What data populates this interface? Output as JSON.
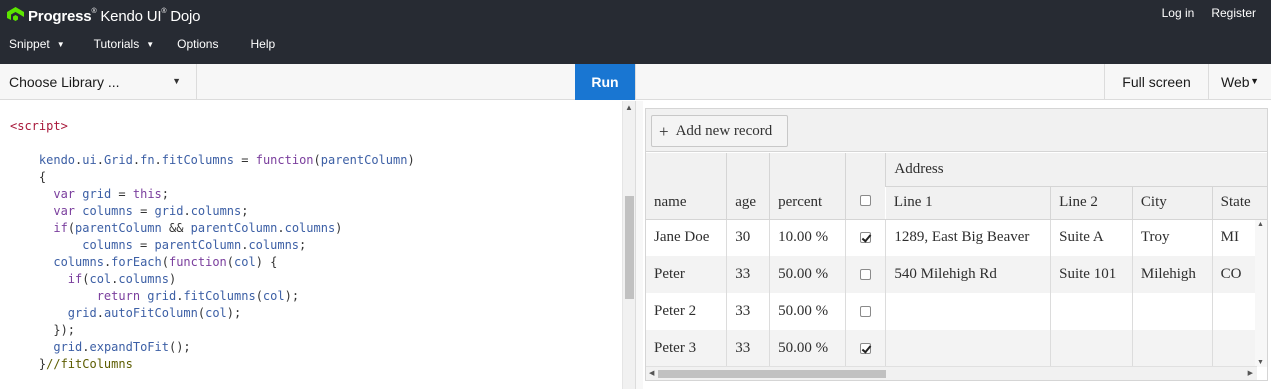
{
  "header": {
    "brand": "Progress",
    "product": "Kendo UI",
    "app": "Dojo",
    "login": "Log in",
    "register": "Register",
    "menu": [
      {
        "label": "Snippet",
        "caret": "▼"
      },
      {
        "label": "Tutorials",
        "caret": "▼"
      },
      {
        "label": "Options"
      },
      {
        "label": "Help"
      }
    ]
  },
  "toolbar": {
    "library_label": "Choose Library ...",
    "run_label": "Run",
    "fullscreen_label": "Full screen",
    "view_label": "Web"
  },
  "code_lines": [
    "<script>",
    "",
    "    kendo.ui.Grid.fn.fitColumns = function(parentColumn)",
    "    {",
    "      var grid = this;",
    "      var columns = grid.columns;",
    "      if(parentColumn && parentColumn.columns)",
    "          columns = parentColumn.columns;",
    "      columns.forEach(function(col) {",
    "        if(col.columns)",
    "            return grid.fitColumns(col);",
    "        grid.autoFitColumn(col);",
    "      });",
    "      grid.expandToFit();",
    "    }//fitColumns"
  ],
  "grid": {
    "add_label": "Add new record",
    "group_header": "Address",
    "columns": [
      "name",
      "age",
      "percent",
      "",
      "Line 1",
      "Line 2",
      "City",
      "State"
    ],
    "rows": [
      {
        "name": "Jane Doe",
        "age": "30",
        "percent": "10.00 %",
        "checked": true,
        "line1": "1289, East Big Beaver",
        "line2": "Suite A",
        "city": "Troy",
        "state": "MI"
      },
      {
        "name": "Peter",
        "age": "33",
        "percent": "50.00 %",
        "checked": false,
        "line1": "540 Milehigh Rd",
        "line2": "Suite 101",
        "city": "Milehigh",
        "state": "CO"
      },
      {
        "name": "Peter 2",
        "age": "33",
        "percent": "50.00 %",
        "checked": false,
        "line1": "",
        "line2": "",
        "city": "",
        "state": ""
      },
      {
        "name": "Peter 3",
        "age": "33",
        "percent": "50.00 %",
        "checked": true,
        "line1": "",
        "line2": "",
        "city": "",
        "state": ""
      }
    ]
  },
  "colors": {
    "header_bg": "#272b33",
    "run_button": "#1976d2",
    "logo_green": "#5ce500"
  },
  "icons": [
    "progress-logo-icon",
    "chevron-down-icon",
    "plus-icon",
    "checkbox-icon",
    "scroll-arrow-icon"
  ]
}
